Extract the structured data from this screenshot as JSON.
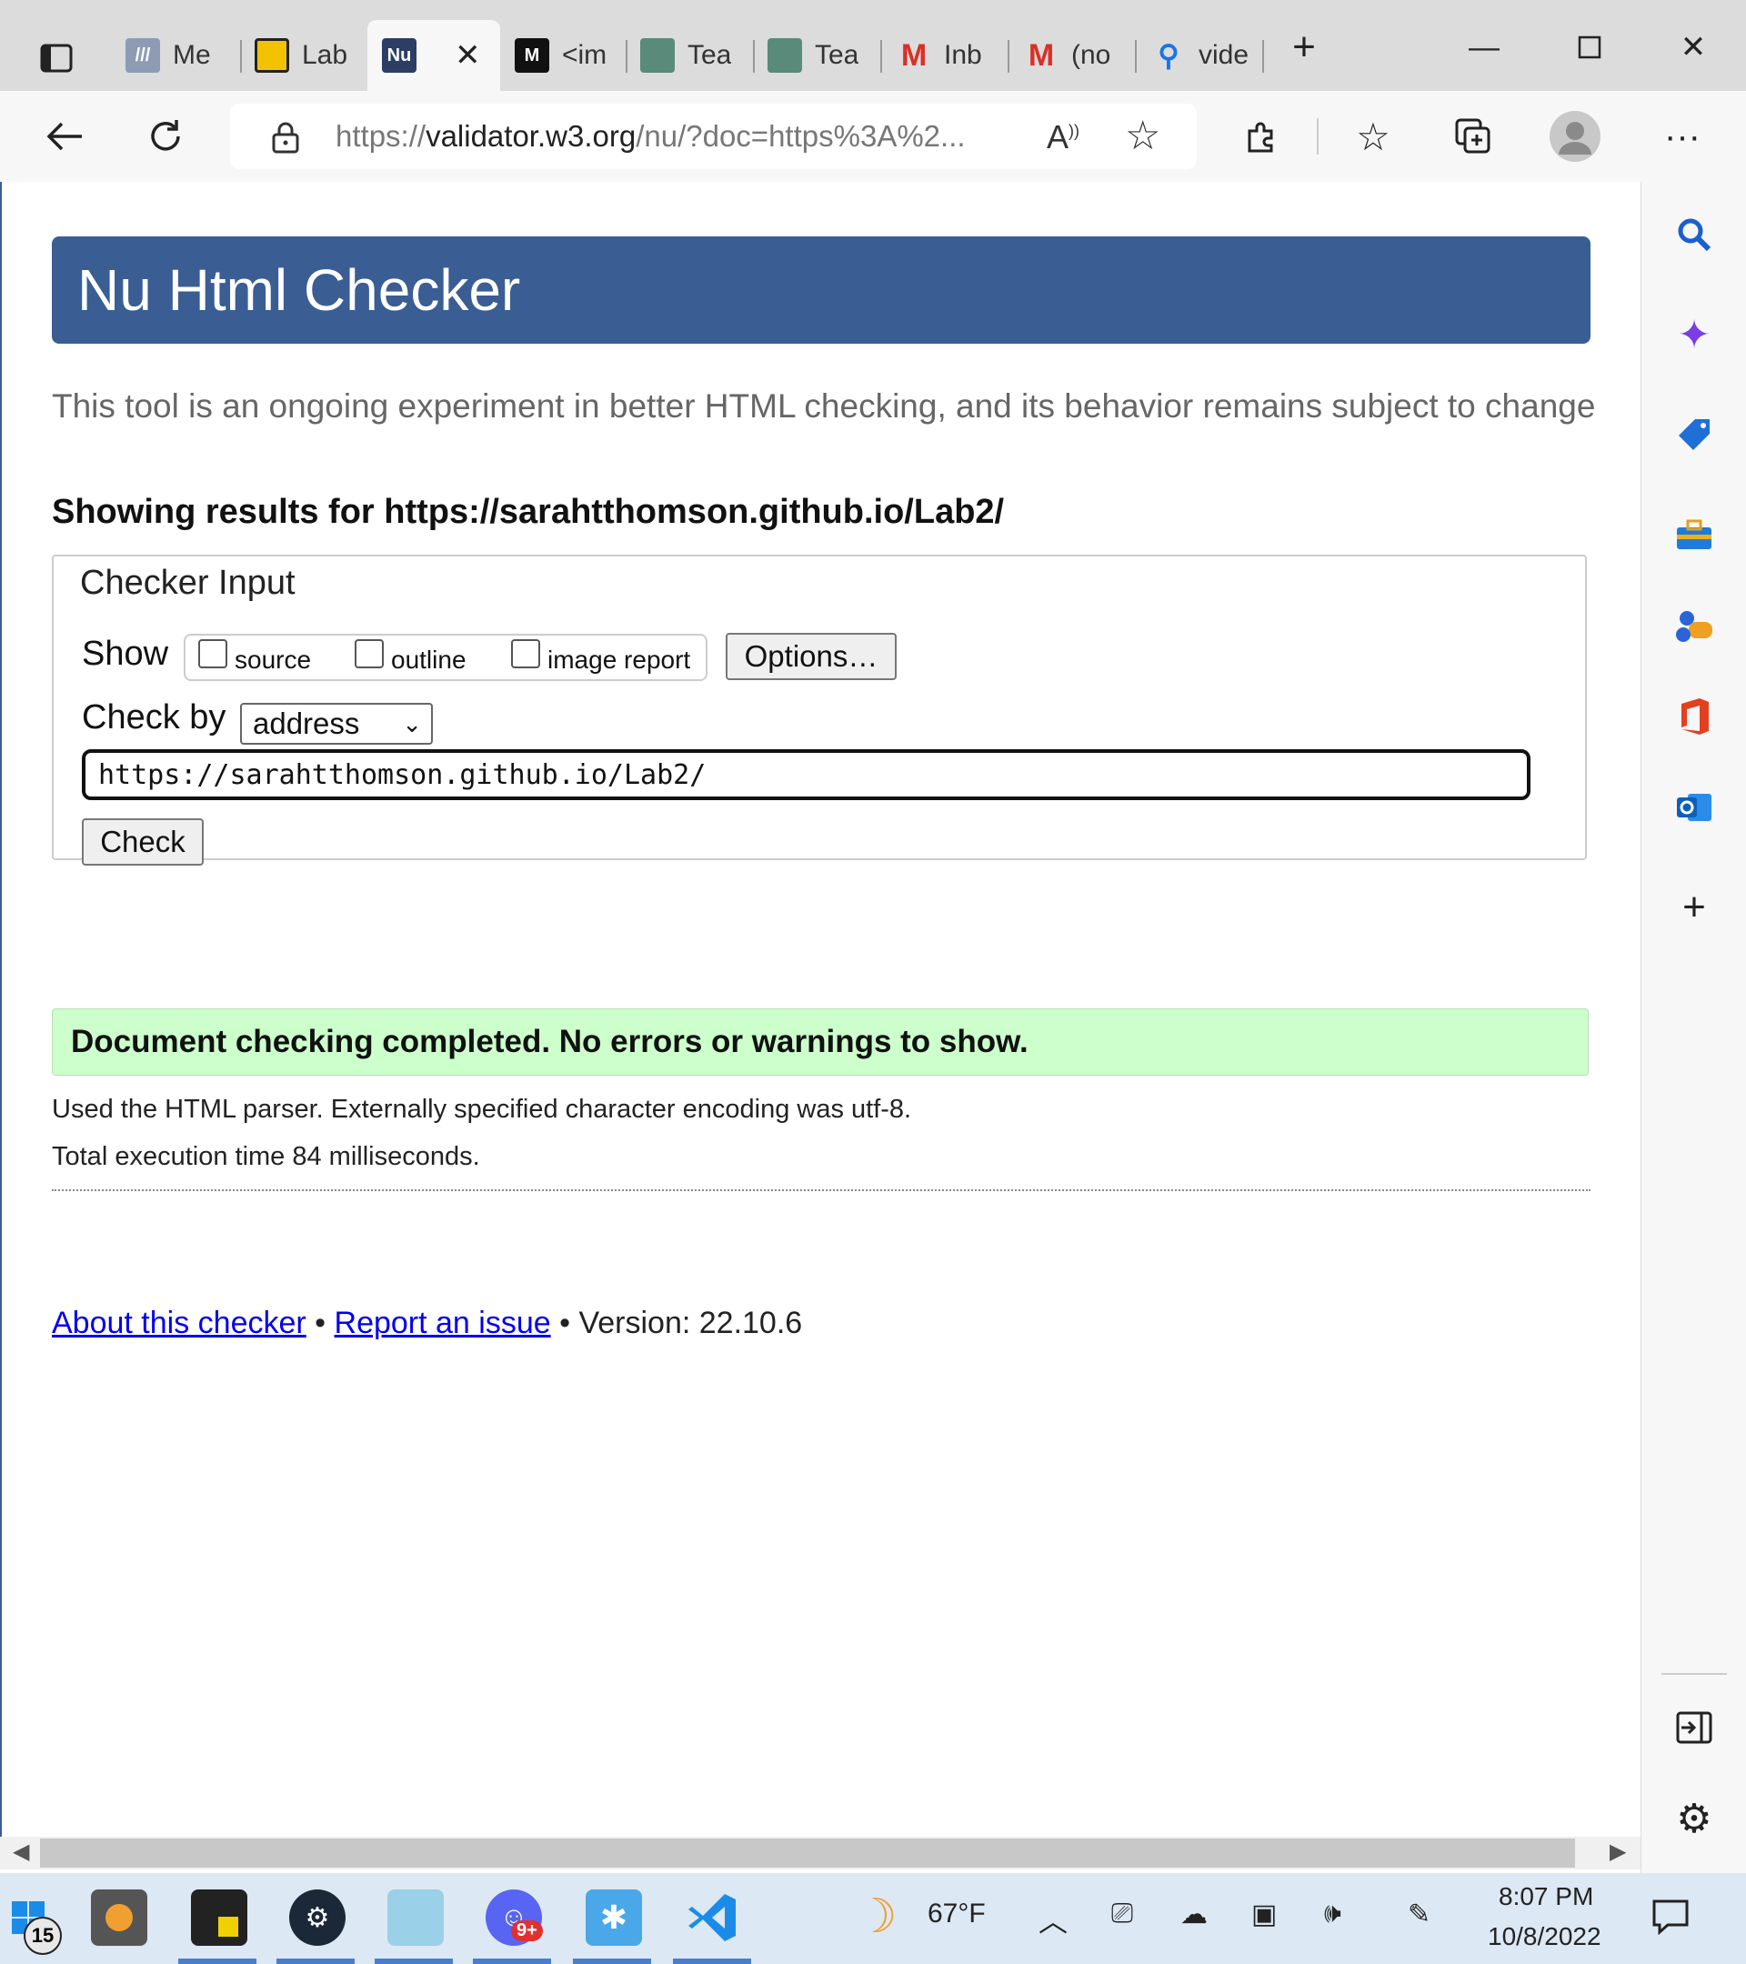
{
  "browser": {
    "tabs": [
      {
        "label": "Me",
        "icon": "mediaplus-icon",
        "color": "#8d9bb5"
      },
      {
        "label": "Lab",
        "icon": "lab-icon",
        "color": "#f2c200"
      },
      {
        "label": "",
        "icon": "validator-icon",
        "color": "#2c3e63"
      },
      {
        "label": "<im",
        "icon": "m-icon",
        "color": "#111111"
      },
      {
        "label": "Tea",
        "icon": "tea-icon",
        "color": "#5a8a7a"
      },
      {
        "label": "Tea",
        "icon": "tea-icon",
        "color": "#5a8a7a"
      },
      {
        "label": "Inb",
        "icon": "gmail-icon",
        "color": "#d93025"
      },
      {
        "label": "(no",
        "icon": "gmail-icon",
        "color": "#d93025"
      },
      {
        "label": "vide",
        "icon": "search-icon",
        "color": "#1a73e8"
      }
    ],
    "address": {
      "prefix": "https://",
      "host": "validator.w3.org",
      "rest": "/nu/?doc=https%3A%2..."
    }
  },
  "page": {
    "title": "Nu Html Checker",
    "intro": "This tool is an ongoing experiment in better HTML checking, and its behavior remains subject to change",
    "results_heading": "Showing results for https://sarahtthomson.github.io/Lab2/",
    "checker_input": {
      "legend": "Checker Input",
      "show_label": "Show",
      "options": [
        {
          "label": "source",
          "checked": false
        },
        {
          "label": "outline",
          "checked": false
        },
        {
          "label": "image report",
          "checked": false
        }
      ],
      "options_button": "Options…",
      "check_by_label": "Check by",
      "check_by_value": "address",
      "url_value": "https://sarahtthomson.github.io/Lab2/",
      "check_button": "Check"
    },
    "success_message": "Document checking completed. No errors or warnings to show.",
    "parser_info": "Used the HTML parser. Externally specified character encoding was utf-8.",
    "time_info": "Total execution time 84 milliseconds.",
    "footer": {
      "about": "About this checker",
      "bullet": "•",
      "report": "Report an issue",
      "version": "• Version: 22.10.6"
    }
  },
  "taskbar": {
    "start_badge": "15",
    "discord_badge": "9+",
    "weather": "67°F",
    "time": "8:07 PM",
    "date": "10/8/2022"
  }
}
